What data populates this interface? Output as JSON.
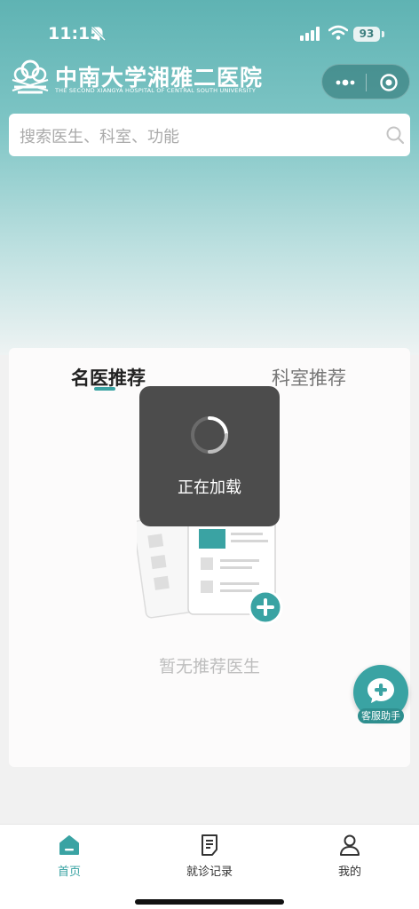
{
  "status_bar": {
    "time": "11:15",
    "battery": "93",
    "icons": [
      "bell-muted-icon",
      "signal-icon",
      "wifi-icon",
      "battery-icon"
    ]
  },
  "header": {
    "logo_name": "中南大学湘雅二医院",
    "logo_subtitle": "THE SECOND XIANGYA HOSPITAL OF CENTRAL SOUTH UNIVERSITY",
    "capsule_icons": [
      "more-dots-icon",
      "close-target-icon"
    ]
  },
  "search": {
    "placeholder": "搜索医生、科室、功能"
  },
  "recommend": {
    "tabs": [
      {
        "label": "名医推荐",
        "active": true
      },
      {
        "label": "科室推荐",
        "active": false
      }
    ],
    "empty_text": "暂无推荐医生"
  },
  "loading": {
    "text": "正在加载"
  },
  "service": {
    "label": "客服助手"
  },
  "tabbar": {
    "items": [
      {
        "label": "首页",
        "icon": "home-icon",
        "active": true
      },
      {
        "label": "就诊记录",
        "icon": "document-icon",
        "active": false
      },
      {
        "label": "我的",
        "icon": "user-icon",
        "active": false
      }
    ]
  },
  "colors": {
    "accent": "#3aa3a3",
    "hero_top": "#5fb3b3",
    "toast_bg": "#4c4c4c"
  }
}
